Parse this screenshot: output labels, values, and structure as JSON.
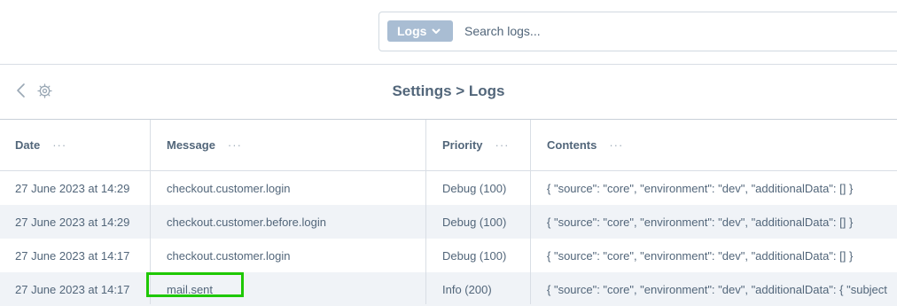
{
  "search": {
    "type_label": "Logs",
    "placeholder": "Search logs..."
  },
  "header": {
    "title": "Settings > Logs"
  },
  "table": {
    "columns": {
      "date": "Date",
      "message": "Message",
      "priority": "Priority",
      "contents": "Contents",
      "menu": "···"
    },
    "rows": [
      {
        "date": "27 June 2023 at 14:29",
        "message": "checkout.customer.login",
        "priority": "Debug (100)",
        "contents": "{ \"source\": \"core\", \"environment\": \"dev\", \"additionalData\": [] }"
      },
      {
        "date": "27 June 2023 at 14:29",
        "message": "checkout.customer.before.login",
        "priority": "Debug (100)",
        "contents": "{ \"source\": \"core\", \"environment\": \"dev\", \"additionalData\": [] }"
      },
      {
        "date": "27 June 2023 at 14:17",
        "message": "checkout.customer.login",
        "priority": "Debug (100)",
        "contents": "{ \"source\": \"core\", \"environment\": \"dev\", \"additionalData\": [] }"
      },
      {
        "date": "27 June 2023 at 14:17",
        "message": "mail.sent",
        "priority": "Info (200)",
        "contents": "{ \"source\": \"core\", \"environment\": \"dev\", \"additionalData\": { \"subject"
      }
    ]
  },
  "colors": {
    "accent_button": "#a9bdd3",
    "text": "#52667a",
    "row_alt": "#f0f3f7",
    "highlight": "#1ec800"
  },
  "icons": [
    "chevron-down-icon",
    "back-arrow-icon",
    "gear-icon",
    "column-menu-icon"
  ]
}
